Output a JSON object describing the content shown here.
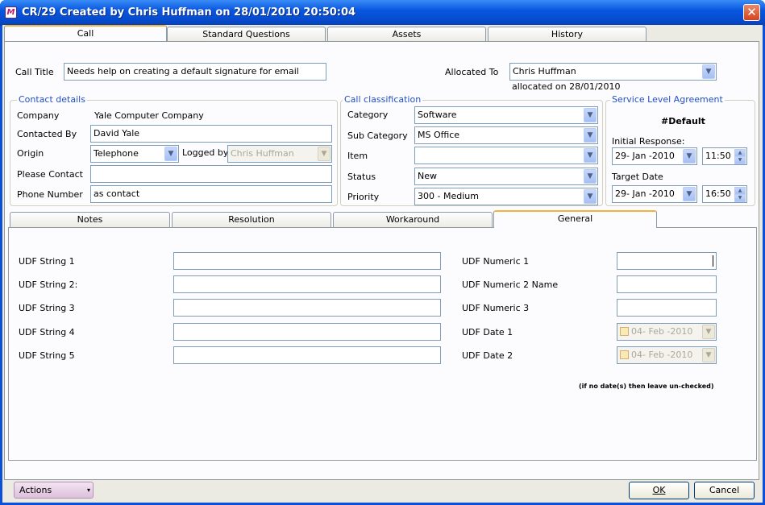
{
  "window": {
    "title": "CR/29 Created by Chris Huffman on 28/01/2010 20:50:04",
    "app_icon": "app-logo-icon",
    "close_icon": "close-icon"
  },
  "top_tabs": [
    {
      "label": "Call"
    },
    {
      "label": "Standard Questions"
    },
    {
      "label": "Assets"
    },
    {
      "label": "History"
    }
  ],
  "call": {
    "title_label": "Call Title",
    "title_value": "Needs help on creating a default signature for email",
    "allocated_label": "Allocated To",
    "allocated_value": "Chris Huffman",
    "allocated_on": "allocated on 28/01/2010"
  },
  "contact": {
    "group_title": "Contact details",
    "company_label": "Company",
    "company_value": "Yale Computer Company",
    "contacted_by_label": "Contacted By",
    "contacted_by_value": "David Yale",
    "origin_label": "Origin",
    "origin_value": "Telephone",
    "logged_by_label": "Logged by",
    "logged_by_value": "Chris Huffman",
    "please_contact_label": "Please Contact",
    "please_contact_value": "",
    "phone_label": "Phone Number",
    "phone_value": "as contact"
  },
  "classification": {
    "group_title": "Call classification",
    "category_label": "Category",
    "category_value": "Software",
    "subcategory_label": "Sub Category",
    "subcategory_value": "MS Office",
    "item_label": "Item",
    "item_value": "",
    "status_label": "Status",
    "status_value": "New",
    "priority_label": "Priority",
    "priority_value": "300 - Medium"
  },
  "sla": {
    "group_title": "Service Level Agreement",
    "name": "#Default",
    "initial_label": "Initial Response:",
    "initial_date": "29- Jan -2010",
    "initial_time": "11:50",
    "target_label": "Target Date",
    "target_date": "29- Jan -2010",
    "target_time": "16:50"
  },
  "lower_tabs": [
    {
      "label": "Notes"
    },
    {
      "label": "Resolution"
    },
    {
      "label": "Workaround"
    },
    {
      "label": "General"
    }
  ],
  "general": {
    "udf_string_1": "UDF String 1",
    "udf_string_2": "UDF String 2:",
    "udf_string_3": "UDF String 3",
    "udf_string_4": "UDF String 4",
    "udf_string_5": "UDF String 5",
    "udf_numeric_1": "UDF Numeric 1",
    "udf_numeric_2": "UDF Numeric 2 Name",
    "udf_numeric_3": "UDF Numeric 3",
    "udf_date_1": "UDF Date 1",
    "udf_date_1_value": "04- Feb -2010",
    "udf_date_2": "UDF Date 2",
    "udf_date_2_value": "04- Feb -2010",
    "hint": "(if no date(s) then leave un-checked)"
  },
  "footer": {
    "actions": "Actions",
    "ok": "OK",
    "cancel": "Cancel"
  }
}
